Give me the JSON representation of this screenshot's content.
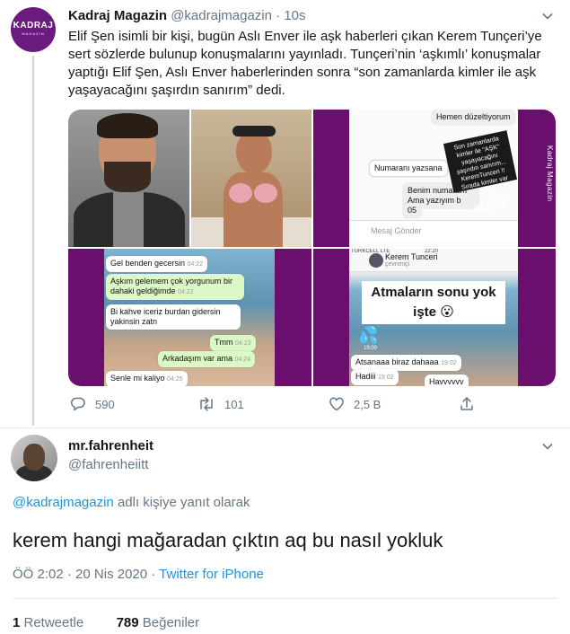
{
  "colors": {
    "brand_purple": "#6b0f6e",
    "link_blue": "#1b95e0",
    "secondary_text": "#657786",
    "primary_text": "#14171a"
  },
  "quoted_tweet": {
    "avatar_text": "KADRAJ",
    "avatar_subtext": "MAGAZIN",
    "name": "Kadraj Magazin",
    "handle": "@kadrajmagazin",
    "separator": "·",
    "time": "10s",
    "text": "Elif Şen isimli bir kişi, bugün Aslı Enver ile aşk haberleri çıkan Kerem Tunçeri’ye sert sözlerde bulunup konuşmalarını yayınladı. Tunçeri’nin ‘aşkımlı’ konuşmalar yaptığı Elif Şen, Aslı Enver haberlerinden sonra “son zamanlarda kimler ile aşk yaşayacağını şaşırdın sanırım” dedi.",
    "media": {
      "instagram": {
        "top_bubble": "Hemen düzeltiyorum",
        "bubble_1": "Numaranı yazsana",
        "bubble_2": "Benim numaram Ama yazıyım b",
        "bubble_3": "05",
        "sticker_small": "Son zamanlarda kimler ile \"AŞK\" yaşayacağını şaşırdın sanırım... KeremTunceri !! Sırada kimler var daha",
        "sticker_big": "acaba",
        "message_placeholder": "Mesaj Gönder",
        "watermark": "Kadraj Magazin"
      },
      "whatsapp_1": {
        "messages": [
          {
            "text": "Gel benden gecersin",
            "time": "04:22"
          },
          {
            "text": "Aşkım gelemem çok yorgunum bir",
            "time": ""
          },
          {
            "text": "dahaki geldiğimde",
            "time": "04:22"
          },
          {
            "text": "Bi kahve iceriz burdan gidersin",
            "time": ""
          },
          {
            "text": "yakinsin zatn",
            "time": "04:23"
          },
          {
            "text": "Tmm",
            "time": "04:23"
          },
          {
            "text": "Arkadaşım var ama",
            "time": "04:24"
          },
          {
            "text": "Senle mi kaliyo",
            "time": "04:25"
          }
        ]
      },
      "whatsapp_2": {
        "status_left": "TURKCELL LTE",
        "status_time": "22:20",
        "contact_name": "Kerem Tunceri",
        "contact_sub": "çevrimiçi",
        "caption_line1": "Atmaların sonu yok",
        "caption_line2": "işte",
        "emoji": "😮",
        "drops": "💦",
        "time_label": "19:00",
        "messages": [
          {
            "text": "Atsanaaa biraz dahaaa",
            "time": "19:02"
          },
          {
            "text": "Hadiii",
            "time": "19:02"
          },
          {
            "text": "Havvvvvv",
            "time": ""
          }
        ]
      }
    },
    "actions": {
      "replies": "590",
      "retweets": "101",
      "likes": "2,5 B"
    }
  },
  "reply_tweet": {
    "name": "mr.fahrenheit",
    "handle": "@fahrenheiitt",
    "reply_to_mention": "@kadrajmagazin",
    "reply_to_suffix": " adlı kişiye yanıt olarak",
    "text": "kerem hangi mağaradan çıktın aq bu nasıl yokluk",
    "time": "ÖÖ 2:02",
    "date_separator": " · ",
    "date": "20 Nis 2020",
    "source_separator": " · ",
    "source": "Twitter for iPhone",
    "retweet_count": "1",
    "retweet_label": " Retweetle",
    "like_count": "789",
    "like_label": " Beğeniler"
  }
}
